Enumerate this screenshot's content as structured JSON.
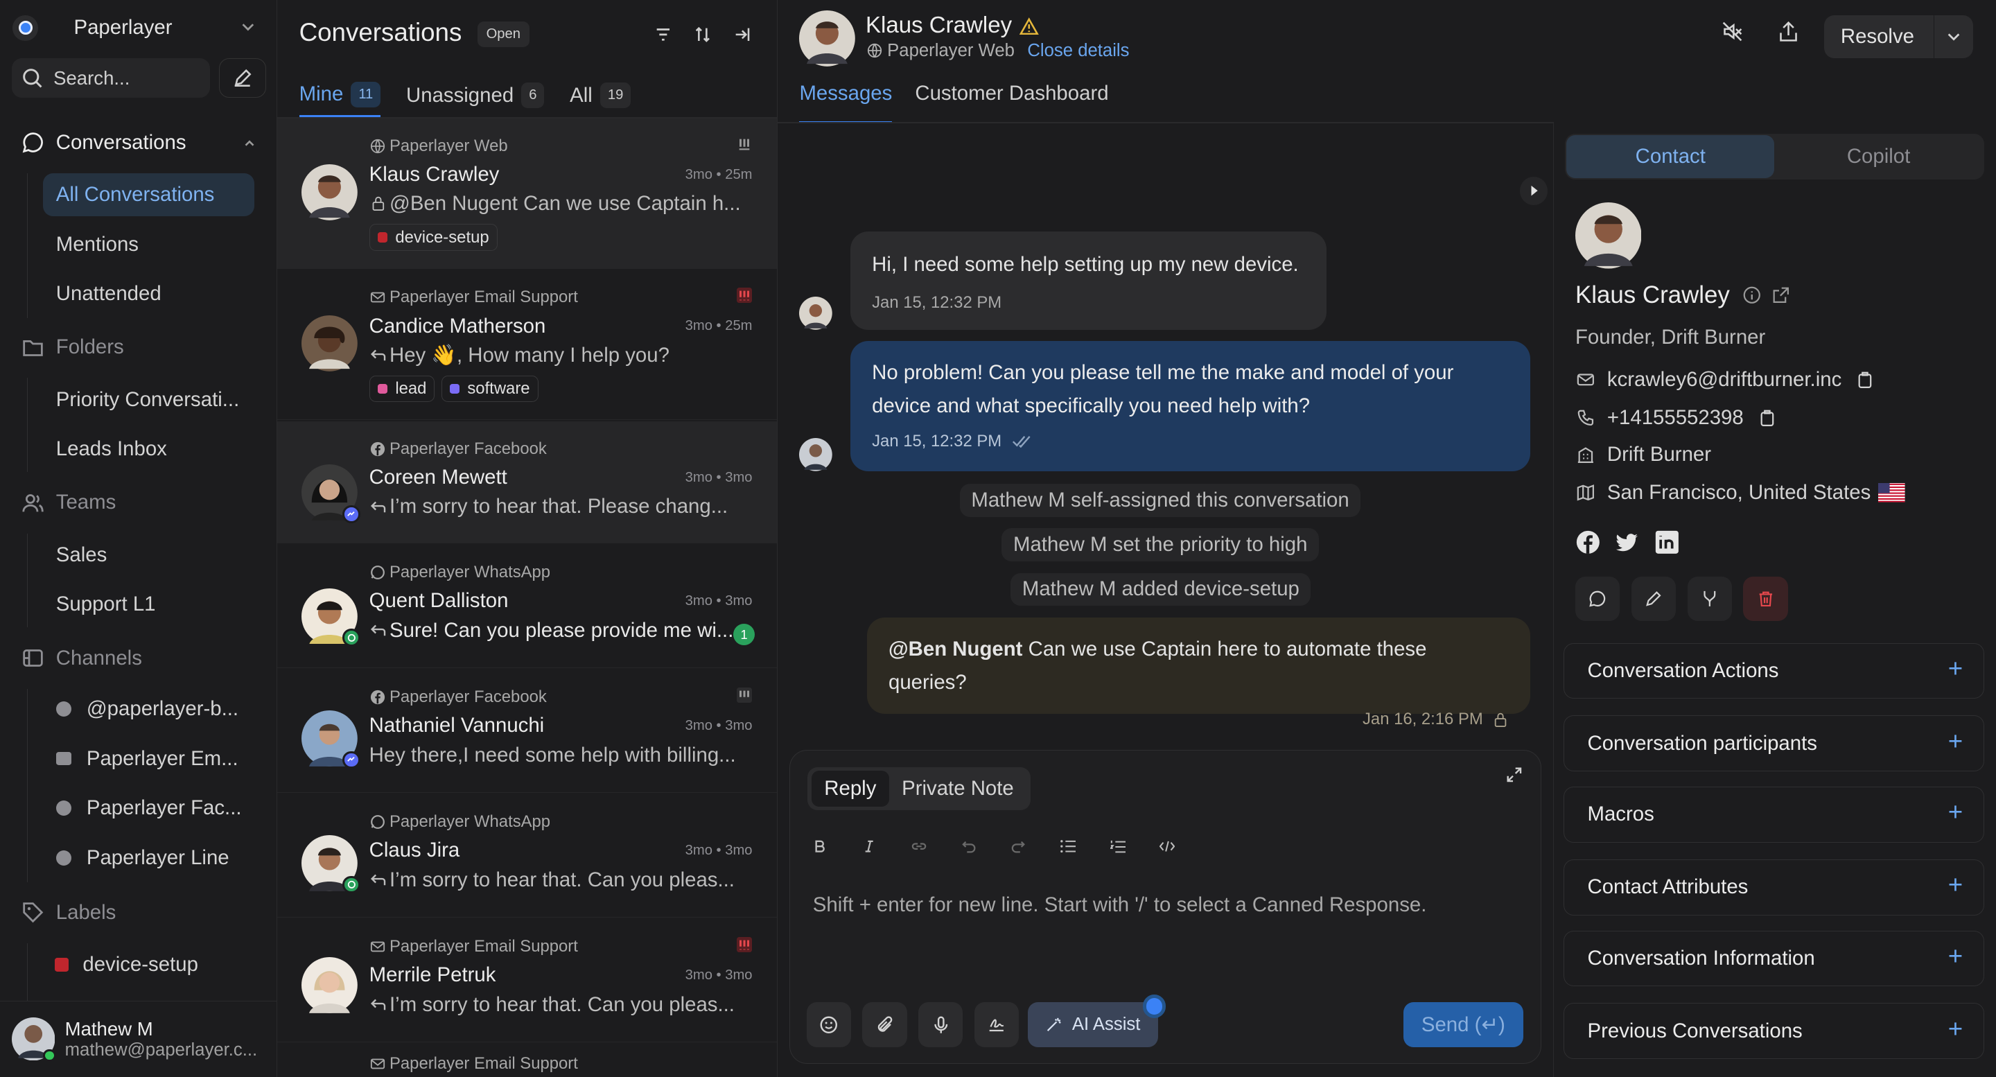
{
  "sidebar": {
    "account_name": "Paperlayer",
    "search_placeholder": "Search...",
    "sections": {
      "conversations": "Conversations",
      "folders": "Folders",
      "teams": "Teams",
      "channels": "Channels",
      "labels": "Labels"
    },
    "conversation_items": [
      "All Conversations",
      "Mentions",
      "Unattended"
    ],
    "folder_items": [
      "Priority Conversati...",
      "Leads Inbox"
    ],
    "team_items": [
      "Sales",
      "Support L1"
    ],
    "channel_items": [
      "@paperlayer-b...",
      "Paperlayer Em...",
      "Paperlayer Fac...",
      "Paperlayer Line"
    ],
    "label_items": [
      "device-setup"
    ],
    "user": {
      "name": "Mathew M",
      "email": "mathew@paperlayer.c..."
    }
  },
  "conv_list": {
    "title": "Conversations",
    "status_badge": "Open",
    "tabs": [
      {
        "label": "Mine",
        "count": "11"
      },
      {
        "label": "Unassigned",
        "count": "6"
      },
      {
        "label": "All",
        "count": "19"
      }
    ],
    "items": [
      {
        "source": "Paperlayer Web",
        "name": "Klaus Crawley",
        "time": "3mo • 25m",
        "message": "@Ben Nugent Can we use Captain h...",
        "labels": [
          "device-setup"
        ]
      },
      {
        "source": "Paperlayer Email Support",
        "name": "Candice Matherson",
        "time": "3mo • 25m",
        "message": "Hey 👋, How many I help you?",
        "labels": [
          "lead",
          "software"
        ]
      },
      {
        "source": "Paperlayer Facebook",
        "name": "Coreen Mewett",
        "time": "3mo • 3mo",
        "message": "I’m sorry to hear that. Please chang..."
      },
      {
        "source": "Paperlayer WhatsApp",
        "name": "Quent Dalliston",
        "time": "3mo • 3mo",
        "message": "Sure! Can you please provide me wi...",
        "unread": "1"
      },
      {
        "source": "Paperlayer Facebook",
        "name": "Nathaniel Vannuchi",
        "time": "3mo • 3mo",
        "message": "Hey there,I need some help with billing..."
      },
      {
        "source": "Paperlayer WhatsApp",
        "name": "Claus Jira",
        "time": "3mo • 3mo",
        "message": "I’m sorry to hear that. Can you pleas..."
      },
      {
        "source": "Paperlayer Email Support",
        "name": "Merrile Petruk",
        "time": "3mo • 3mo",
        "message": "I’m sorry to hear that. Can you pleas..."
      },
      {
        "source": "Paperlayer Email Support",
        "name": "",
        "time": "",
        "message": ""
      }
    ]
  },
  "conversation": {
    "contact_name": "Klaus Crawley",
    "inbox": "Paperlayer Web",
    "close_details": "Close details",
    "resolve_label": "Resolve",
    "tabs": [
      "Messages",
      "Customer Dashboard"
    ],
    "messages": [
      {
        "text": "Hi, I need some help setting up my new device.",
        "time": "Jan 15, 12:32 PM"
      },
      {
        "text": "No problem! Can you please tell me the make and model of your device and what specifically you need help with?",
        "time": "Jan 15, 12:32 PM"
      }
    ],
    "activities": [
      "Mathew M self-assigned this conversation",
      "Mathew M set the priority to high",
      "Mathew M added device-setup"
    ],
    "note": {
      "mention": "@Ben Nugent",
      "text": " Can we use Captain here to automate these queries?",
      "time": "Jan 16, 2:16 PM"
    }
  },
  "editor": {
    "modes": [
      "Reply",
      "Private Note"
    ],
    "placeholder": "Shift + enter for new line. Start with '/' to select a Canned Response.",
    "ai_assist": "AI Assist",
    "send": "Send (↵)"
  },
  "contact_panel": {
    "tabs": [
      "Contact",
      "Copilot"
    ],
    "name": "Klaus Crawley",
    "title": "Founder, Drift Burner",
    "email": "kcrawley6@driftburner.inc",
    "phone": "+14155552398",
    "company": "Drift Burner",
    "location": "San Francisco, United States",
    "sections": [
      "Conversation Actions",
      "Conversation participants",
      "Macros",
      "Contact Attributes",
      "Conversation Information",
      "Previous Conversations"
    ]
  },
  "colors": {
    "accent": "#3b82f6",
    "outgoing_bubble": "#1f3a5f",
    "note_bubble": "#2d2a22",
    "priority_urgent": "#e5484d",
    "label_device_setup": "#c0262d",
    "label_lead": "#e05a9c",
    "label_software": "#7b6cf6"
  }
}
